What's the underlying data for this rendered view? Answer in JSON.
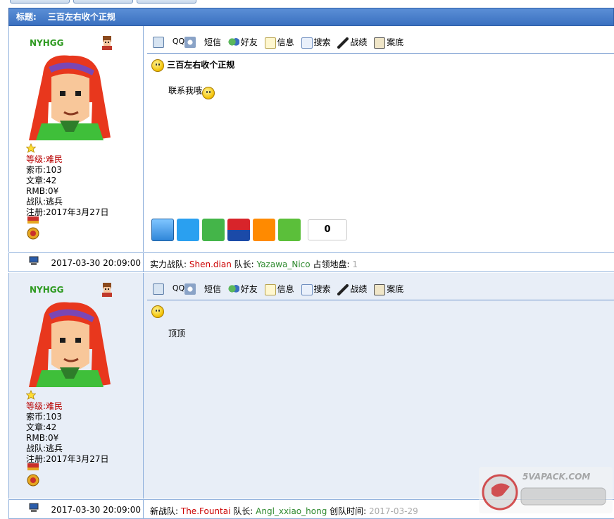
{
  "topic": {
    "label": "标题:",
    "title": "三百左右收个正规"
  },
  "toolbar": {
    "items": [
      {
        "label": "",
        "icon": "picture-icon"
      },
      {
        "label": "QQ",
        "icon": "qq-icon"
      },
      {
        "label": "短信",
        "icon": "message-icon"
      },
      {
        "label": "好友",
        "icon": "friends-icon"
      },
      {
        "label": "信息",
        "icon": "info-icon"
      },
      {
        "label": "搜索",
        "icon": "search-icon"
      },
      {
        "label": "战绩",
        "icon": "shooter-icon"
      },
      {
        "label": "案底",
        "icon": "record-icon"
      }
    ]
  },
  "posts": [
    {
      "user": {
        "name": "NYHGG",
        "level_label": "等级:",
        "level": "难民",
        "coins_label": "索币:",
        "coins": "103",
        "articles_label": "文章:",
        "articles": "42",
        "rmb_label": "RMB:",
        "rmb": "0¥",
        "team_label": "战队:",
        "team": "逃兵",
        "reg_label": "注册:",
        "reg": "2017年3月27日"
      },
      "title": "三百左右收个正规",
      "body": "联系我哦",
      "share_count": "0",
      "date": "2017-03-30 20:09:00",
      "footer": {
        "a_label": "实力战队:",
        "a_value": "Shen.dian",
        "b_label": "队长:",
        "b_value": "Yazawa_Nico",
        "c_label": "占领地盘:",
        "c_value": "1"
      }
    },
    {
      "user": {
        "name": "NYHGG",
        "level_label": "等级:",
        "level": "难民",
        "coins_label": "索币:",
        "coins": "103",
        "articles_label": "文章:",
        "articles": "42",
        "rmb_label": "RMB:",
        "rmb": "0¥",
        "team_label": "战队:",
        "team": "逃兵",
        "reg_label": "注册:",
        "reg": "2017年3月27日"
      },
      "title": "",
      "body": "顶顶",
      "date": "2017-03-30 20:09:00",
      "footer": {
        "a_label": "新战队:",
        "a_value": "The.Fountai",
        "b_label": "队长:",
        "b_value": "Angl_xxiao_hong",
        "c_label": "创队时间:",
        "c_value": "2017-03-29"
      }
    }
  ],
  "colors": {
    "title_bar": "#4a80cc",
    "border": "#8fb0dc",
    "alt_bg": "#e8eef7",
    "username": "#2e9a20",
    "level": "#b80000"
  },
  "watermark_text": "5VAPACK.COM"
}
